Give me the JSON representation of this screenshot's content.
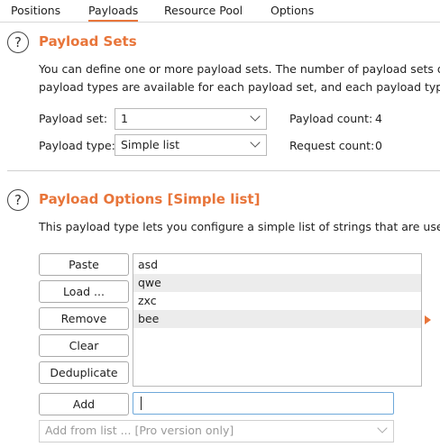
{
  "tabs": [
    {
      "label": "Positions"
    },
    {
      "label": "Payloads"
    },
    {
      "label": "Resource Pool"
    },
    {
      "label": "Options"
    }
  ],
  "help_icon": "?",
  "payload_sets": {
    "title": "Payload Sets",
    "desc_line1": "You can define one or more payload sets. The number of payload sets d",
    "desc_line2": "payload types are available for each payload set, and each payload type c",
    "set_label": "Payload set:",
    "set_value": "1",
    "type_label": "Payload type:",
    "type_value": "Simple list",
    "count_label": "Payload count:",
    "count_value": "4",
    "request_label": "Request count:",
    "request_value": "0"
  },
  "payload_options": {
    "title": "Payload Options [Simple list]",
    "desc": "This payload type lets you configure a simple list of strings that are used",
    "buttons": {
      "paste": "Paste",
      "load": "Load ...",
      "remove": "Remove",
      "clear": "Clear",
      "deduplicate": "Deduplicate",
      "add": "Add"
    },
    "items": [
      "asd",
      "qwe",
      "zxc",
      "bee"
    ],
    "add_input_value": "",
    "add_from_list": "Add from list ... [Pro version only]"
  },
  "colors": {
    "accent": "#e8753a",
    "focus_border": "#6ea8d9",
    "alt_row": "#ececec"
  },
  "icons": [
    "help-icon",
    "chevron-down-icon",
    "arrow-right-icon"
  ]
}
